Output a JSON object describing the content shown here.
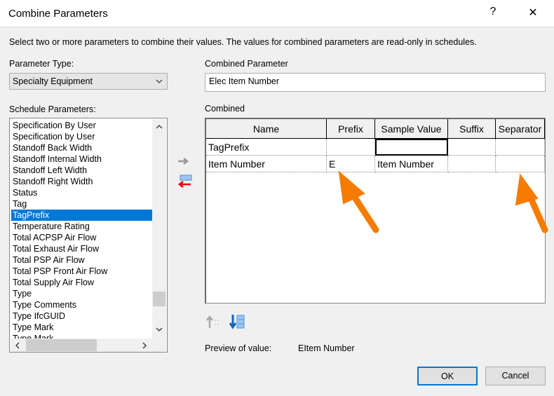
{
  "window": {
    "title": "Combine Parameters",
    "help": "?",
    "close": "✕"
  },
  "instruction": "Select two or more parameters to combine their values.  The values for combined parameters are read-only in schedules.",
  "parameter_type": {
    "label": "Parameter Type:",
    "value": "Specialty Equipment"
  },
  "combined_parameter": {
    "label": "Combined Parameter",
    "value": "Elec Item Number"
  },
  "schedule_parameters": {
    "label": "Schedule Parameters:",
    "selected": "TagPrefix",
    "items": [
      "Specification By User",
      "Specification by User",
      "Standoff Back Width",
      "Standoff Internal Width",
      "Standoff Left Width",
      "Standoff Right Width",
      "Status",
      "Tag",
      "TagPrefix",
      "Temperature Rating",
      "Total ACPSP Air Flow",
      "Total Exhaust Air Flow",
      "Total PSP Air Flow",
      "Total PSP Front Air Flow",
      "Total Supply Air Flow",
      "Type",
      "Type Comments",
      "Type IfcGUID",
      "Type Mark",
      "Type Mark"
    ]
  },
  "combined": {
    "label": "Combined",
    "columns": [
      "Name",
      "Prefix",
      "Sample Value",
      "Suffix",
      "Separator"
    ],
    "rows": [
      [
        "TagPrefix",
        "",
        "",
        "",
        ""
      ],
      [
        "Item Number",
        "E",
        "Item Number",
        "",
        ""
      ]
    ]
  },
  "preview": {
    "label": "Preview of value:",
    "value": "EItem Number"
  },
  "buttons": {
    "ok": "OK",
    "cancel": "Cancel"
  },
  "colors": {
    "selection": "#0078d7",
    "annotation_arrow": "#f57c00"
  }
}
